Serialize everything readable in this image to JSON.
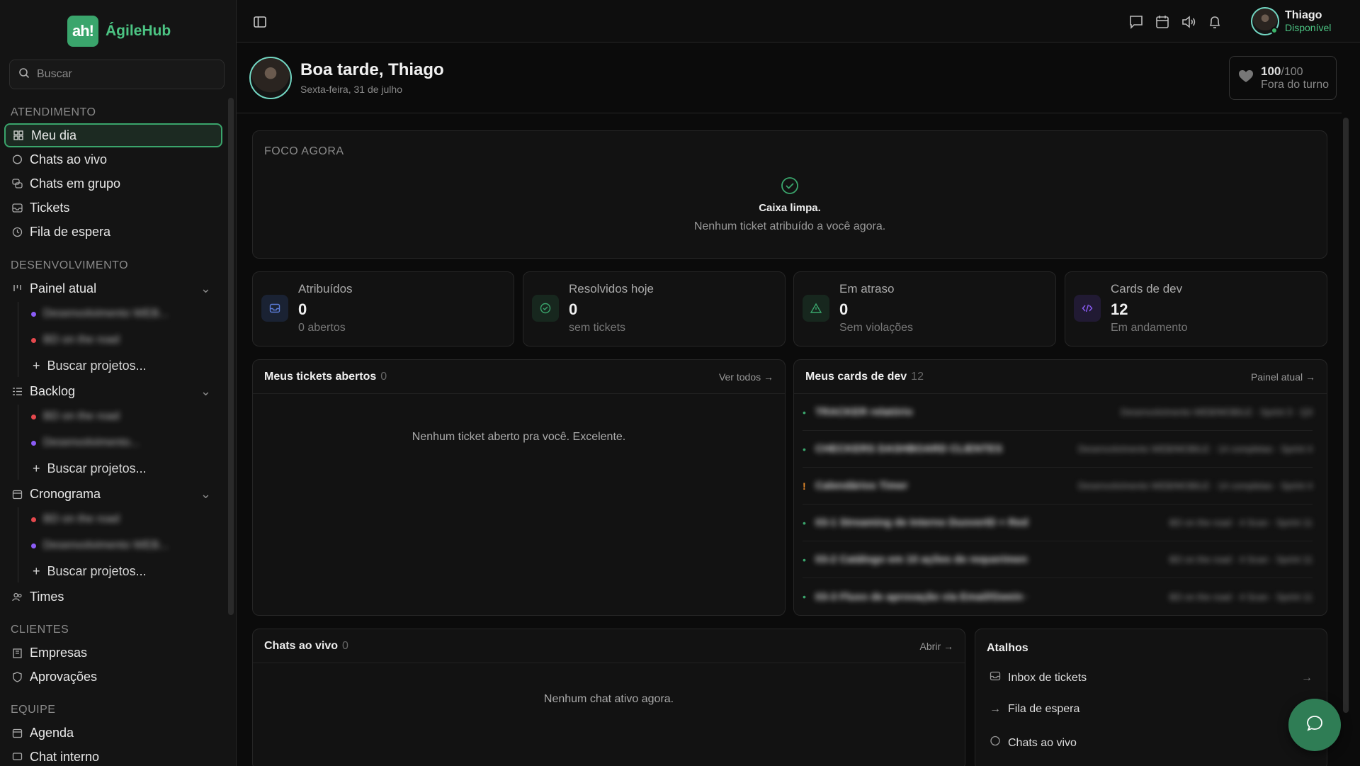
{
  "brand": {
    "logo_mark": "ah!",
    "name": "ÁgileHub"
  },
  "search": {
    "placeholder": "Buscar"
  },
  "sidebar": {
    "sections": [
      {
        "title": "ATENDIMENTO"
      },
      {
        "title": "DESENVOLVIMENTO"
      },
      {
        "title": "CLIENTES"
      },
      {
        "title": "EQUIPE"
      }
    ],
    "atendimento": [
      "Meu dia",
      "Chats ao vivo",
      "Chats em grupo",
      "Tickets",
      "Fila de espera"
    ],
    "desenvolvimento": {
      "painel_atual": {
        "label": "Painel atual",
        "items": [
          "Desenvolvimento WEB...",
          "BD on the road"
        ],
        "add": "Buscar projetos..."
      },
      "backlog": {
        "label": "Backlog",
        "items": [
          "BD on the road",
          "Desenvolvimento..."
        ],
        "add": "Buscar projetos..."
      },
      "cronograma": {
        "label": "Cronograma",
        "items": [
          "BD on the road",
          "Desenvolvimento WEB..."
        ],
        "add": "Buscar projetos..."
      },
      "times": "Times"
    },
    "clientes": [
      "Empresas",
      "Aprovações"
    ],
    "equipe": [
      "Agenda",
      "Chat interno"
    ]
  },
  "user": {
    "name": "Thiago",
    "status": "Disponível"
  },
  "header": {
    "greeting": "Boa tarde, Thiago",
    "date": "Sexta-feira, 31 de julho"
  },
  "score": {
    "value": "100",
    "max": "/100",
    "label": "Fora do turno"
  },
  "focus": {
    "title": "FOCO AGORA",
    "headline": "Caixa limpa.",
    "message": "Nenhum ticket atribuído a você agora."
  },
  "stats": [
    {
      "label": "Atribuídos",
      "value": "0",
      "sub": "0 abertos",
      "icon": "inbox-icon",
      "color": "#5b7bd6"
    },
    {
      "label": "Resolvidos hoje",
      "value": "0",
      "sub": "sem tickets",
      "icon": "check-circle-icon",
      "color": "#3aa56c"
    },
    {
      "label": "Em atraso",
      "value": "0",
      "sub": "Sem violações",
      "icon": "alert-triangle-icon",
      "color": "#3aa56c"
    },
    {
      "label": "Cards de dev",
      "value": "12",
      "sub": "Em andamento",
      "icon": "code-icon",
      "color": "#8b5cf6"
    }
  ],
  "tickets_panel": {
    "title": "Meus tickets abertos",
    "count": "0",
    "link": "Ver todos",
    "empty": "Nenhum ticket aberto pra você. Excelente."
  },
  "dev_panel": {
    "title": "Meus cards de dev",
    "count": "12",
    "link": "Painel atual",
    "rows": [
      {
        "mark": "•",
        "title": "TRACKER relatório",
        "meta": "Desenvolvimento WEB/MOBILE · Sprint 3 · Q3"
      },
      {
        "mark": "•",
        "title": "CHECKERS DASHBOARD CLIENTES",
        "meta": "Desenvolvimento WEB/MOBILE · 14 completas · Sprint 4"
      },
      {
        "mark": "!",
        "title": "Calendários Timer",
        "meta": "Desenvolvimento WEB/MOBILE · 14 completas · Sprint 4"
      },
      {
        "mark": "•",
        "title": "03-1 Streaming de Interno DuoverID + Redes",
        "meta": "BD on the road · 4 Scan · Sprint 11"
      },
      {
        "mark": "•",
        "title": "03-2 Catálogo em 10 ações de requerimento",
        "meta": "BD on the road · 4 Scan · Sprint 11"
      },
      {
        "mark": "•",
        "title": "03-3 Fluxo de aprovação via Email/Gwein + Approvals",
        "meta": "BD on the road · 4 Scan · Sprint 11"
      }
    ]
  },
  "chats_panel": {
    "title": "Chats ao vivo",
    "count": "0",
    "link": "Abrir",
    "empty": "Nenhum chat ativo agora."
  },
  "shortcuts": {
    "title": "Atalhos",
    "items": [
      "Inbox de tickets",
      "Fila de espera",
      "Chats ao vivo"
    ]
  },
  "colors": {
    "accent": "#3aa56c",
    "purple": "#8b5cf6",
    "red": "#e5484d"
  }
}
